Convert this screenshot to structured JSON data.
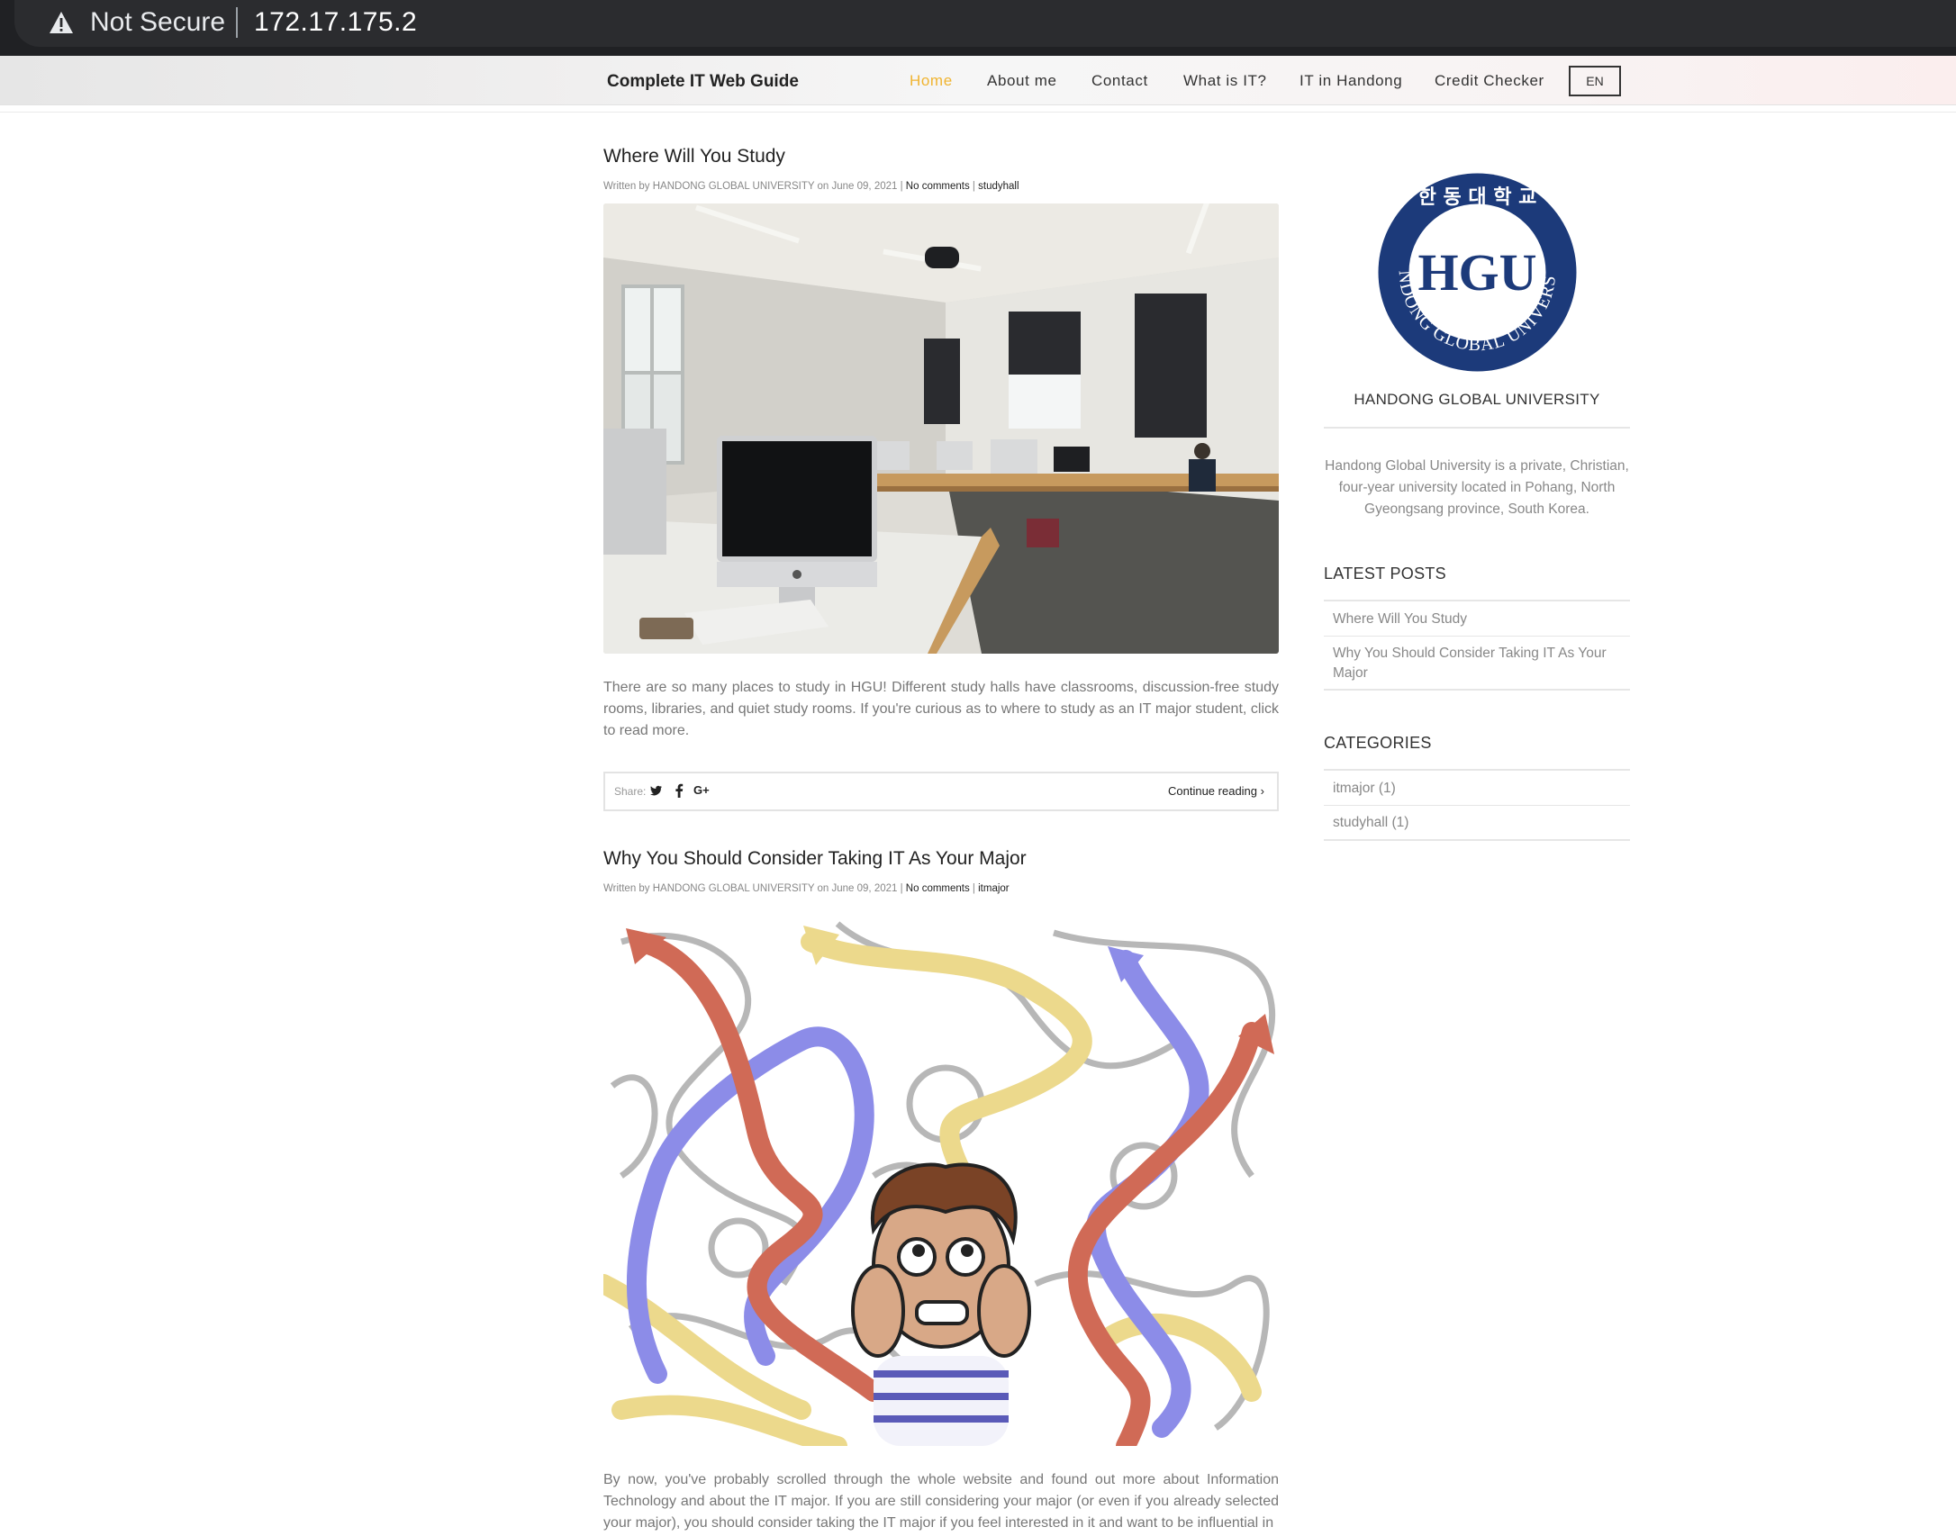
{
  "browser": {
    "security_label": "Not Secure",
    "url": "172.17.175.2"
  },
  "nav": {
    "brand": "Complete IT Web Guide",
    "links": [
      "Home",
      "About me",
      "Contact",
      "What is IT?",
      "IT in Handong",
      "Credit Checker"
    ],
    "active": "Home",
    "lang": "EN",
    "active_color": "#f0b430"
  },
  "posts": [
    {
      "title": "Where Will You Study",
      "meta_prefix": "Written by HANDONG GLOBAL UNIVERSITY on June 09, 2021 |",
      "comments": "No comments",
      "category": "studyhall",
      "excerpt": "There are so many places to study in HGU! Different study halls have classrooms, discussion-free study rooms, libraries, and quiet study rooms. If you're curious as to where to study as an IT major student, click to read more.",
      "share_label": "Share:",
      "continue_label": "Continue reading"
    },
    {
      "title": "Why You Should Consider Taking IT As Your Major",
      "meta_prefix": "Written by HANDONG GLOBAL UNIVERSITY on June 09, 2021 |",
      "comments": "No comments",
      "category": "itmajor",
      "excerpt": "By now, you've probably scrolled through the whole website and found out more about Information Technology and about the IT major. If you are still considering your major (or even if you already selected your major), you should consider taking the IT major if you feel interested in it and want to be influential in"
    }
  ],
  "sidebar": {
    "logo_text": "HGU",
    "logo_ring_text": "HANDONG GLOBAL UNIVERSITY",
    "logo_korean": "한 동 대 학 교",
    "name": "HANDONG GLOBAL UNIVERSITY",
    "description": "Handong Global University is a private, Christian, four-year university located in Pohang, North Gyeongsang province, South Korea.",
    "latest_heading": "LATEST POSTS",
    "latest": [
      "Where Will You Study",
      "Why You Should Consider Taking IT As Your Major"
    ],
    "categories_heading": "CATEGORIES",
    "categories": [
      "itmajor (1)",
      "studyhall (1)"
    ],
    "logo_color": "#1c3a7a"
  }
}
